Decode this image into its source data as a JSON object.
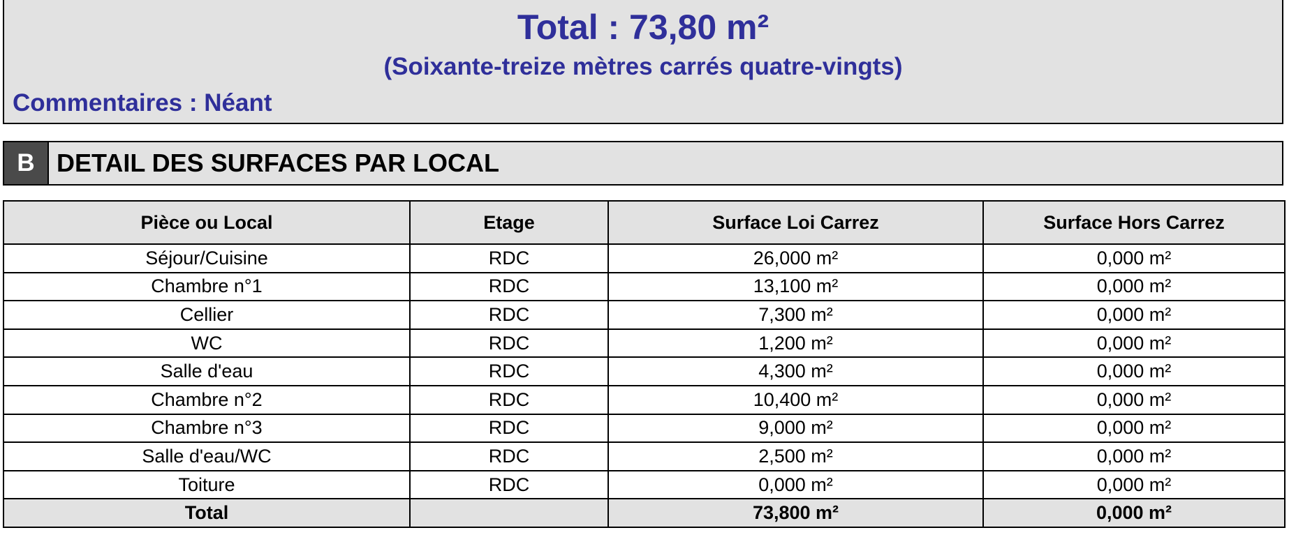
{
  "summary": {
    "total_line": "Total : 73,80 m²",
    "total_words": "(Soixante-treize mètres carrés quatre-vingts)",
    "comments": "Commentaires : Néant"
  },
  "section": {
    "letter": "B",
    "title": "DETAIL DES SURFACES PAR LOCAL"
  },
  "table": {
    "headers": [
      "Pièce ou Local",
      "Etage",
      "Surface Loi Carrez",
      "Surface Hors Carrez"
    ],
    "rows": [
      [
        "Séjour/Cuisine",
        "RDC",
        "26,000 m²",
        "0,000 m²"
      ],
      [
        "Chambre n°1",
        "RDC",
        "13,100 m²",
        "0,000 m²"
      ],
      [
        "Cellier",
        "RDC",
        "7,300 m²",
        "0,000 m²"
      ],
      [
        "WC",
        "RDC",
        "1,200 m²",
        "0,000 m²"
      ],
      [
        "Salle d'eau",
        "RDC",
        "4,300 m²",
        "0,000 m²"
      ],
      [
        "Chambre n°2",
        "RDC",
        "10,400 m²",
        "0,000 m²"
      ],
      [
        "Chambre n°3",
        "RDC",
        "9,000 m²",
        "0,000 m²"
      ],
      [
        "Salle d'eau/WC",
        "RDC",
        "2,500 m²",
        "0,000 m²"
      ],
      [
        "Toiture",
        "RDC",
        "0,000 m²",
        "0,000 m²"
      ]
    ],
    "total": [
      "Total",
      "",
      "73,800 m²",
      "0,000 m²"
    ]
  }
}
